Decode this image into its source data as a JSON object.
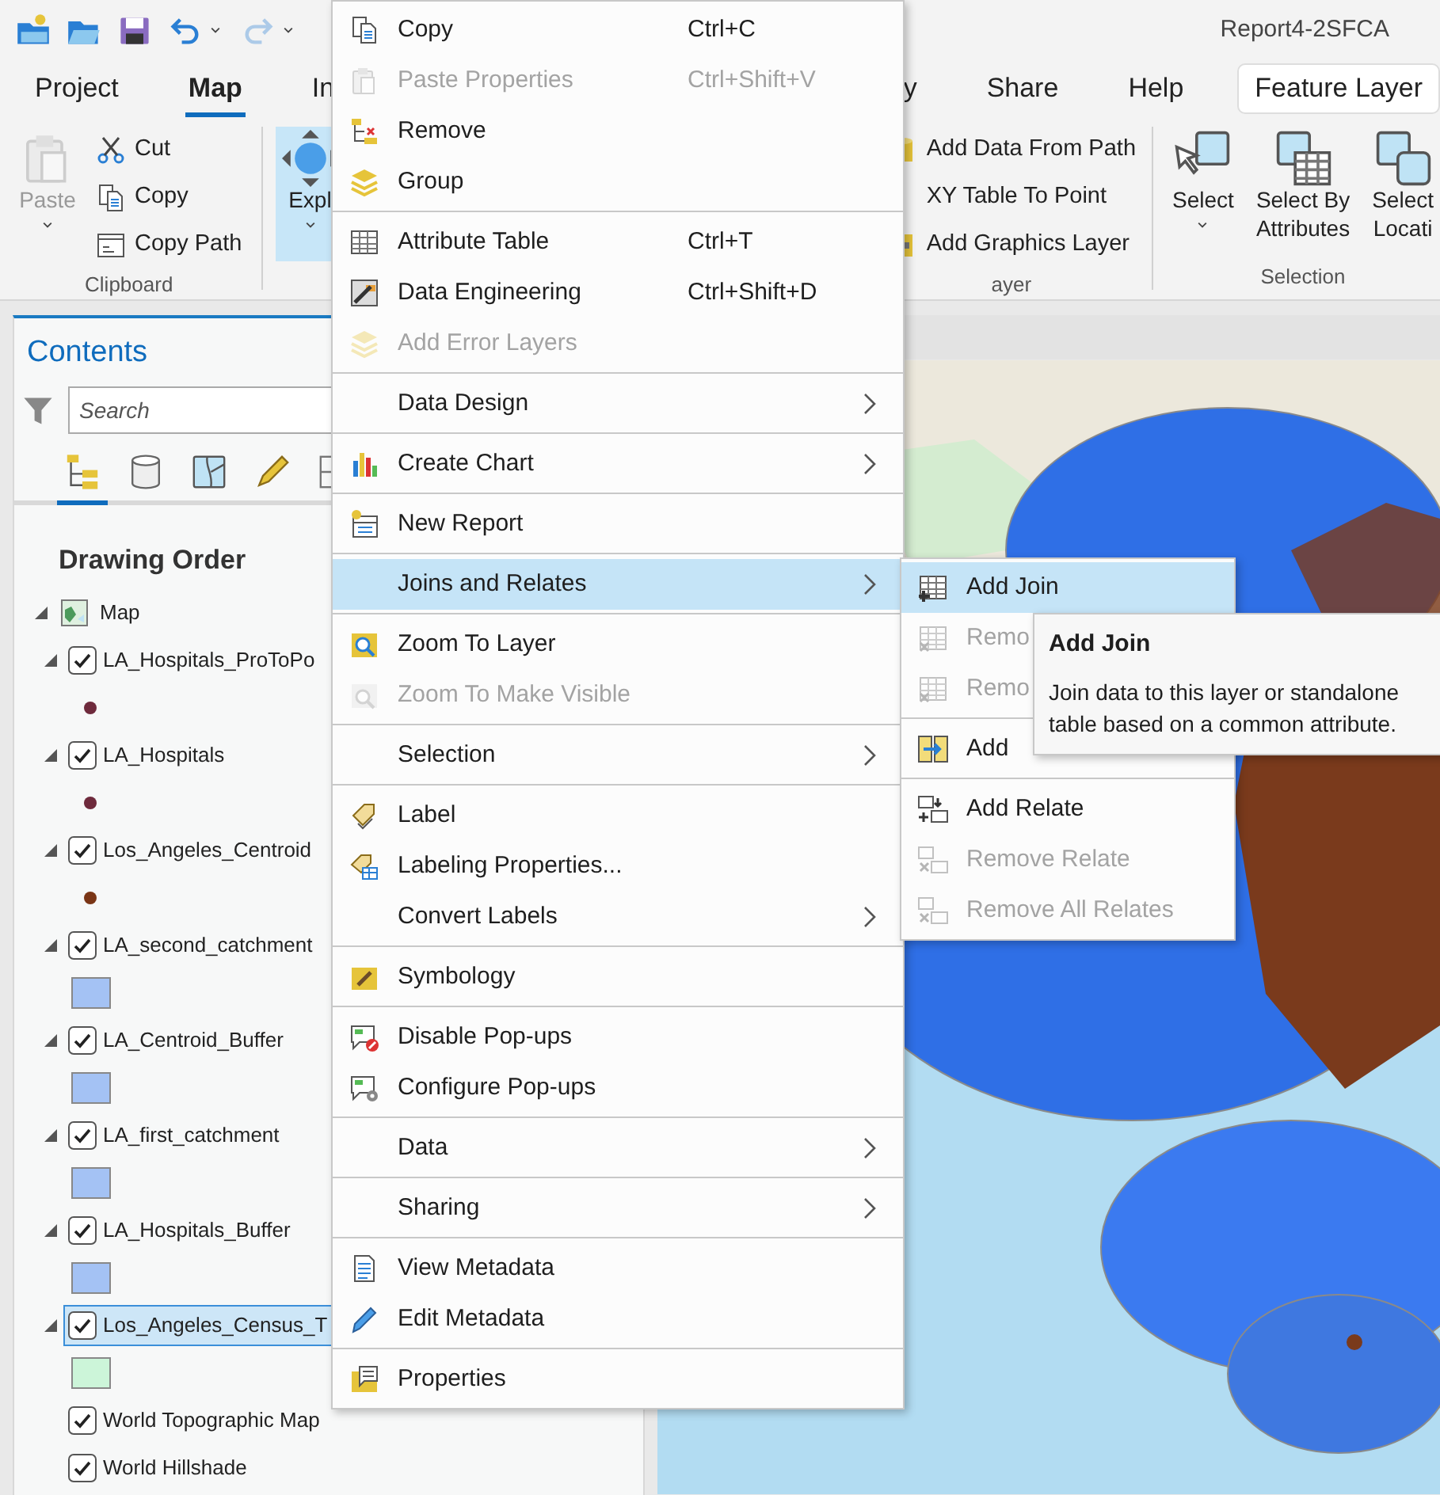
{
  "quick_access": [
    {
      "kind": "new-project",
      "disabled": false
    },
    {
      "kind": "open",
      "disabled": false
    },
    {
      "kind": "save",
      "disabled": false
    },
    {
      "kind": "undo",
      "disabled": false
    },
    {
      "kind": "caret",
      "disabled": false
    },
    {
      "kind": "redo",
      "disabled": true
    },
    {
      "kind": "caret",
      "disabled": false
    }
  ],
  "window": {
    "title": "Report4-2SFCA"
  },
  "ribbon_tabs": [
    {
      "label": "Project",
      "selected": false,
      "kind": "standard"
    },
    {
      "label": "Map",
      "selected": true,
      "kind": "standard"
    },
    {
      "label": "In",
      "selected": false,
      "kind": "standard"
    },
    {
      "label": "y",
      "selected": false,
      "kind": "standard"
    },
    {
      "label": "Share",
      "selected": false,
      "kind": "standard"
    },
    {
      "label": "Help",
      "selected": false,
      "kind": "standard"
    },
    {
      "label": "Feature Layer",
      "selected": false,
      "kind": "contextual"
    }
  ],
  "ribbon_groups": [
    {
      "label": "Clipboard",
      "large": [
        {
          "kind": "paste",
          "label": "Paste",
          "dropdown": true,
          "disabled": true,
          "selected": false
        }
      ],
      "small": [
        {
          "kind": "cut",
          "label": "Cut"
        },
        {
          "kind": "copy",
          "label": "Copy"
        },
        {
          "kind": "copy-path",
          "label": "Copy Path"
        }
      ]
    },
    {
      "large": [
        {
          "kind": "explore",
          "label": "Expl",
          "dropdown": true,
          "disabled": false,
          "selected": true
        }
      ]
    },
    {
      "label": "ayer",
      "small": [
        {
          "kind": "add-data-path",
          "label": "Add Data From Path"
        },
        {
          "kind": "xy-table",
          "label": "XY Table To Point"
        },
        {
          "kind": "add-graphics",
          "label": "Add Graphics Layer"
        }
      ]
    },
    {
      "label": "Selection",
      "large": [
        {
          "kind": "select",
          "label": "Select",
          "dropdown": true,
          "disabled": false,
          "selected": false
        },
        {
          "kind": "select-attributes",
          "label": "Select By\nAttributes",
          "dropdown": false,
          "disabled": false,
          "selected": false
        },
        {
          "kind": "select-location",
          "label": "Select\nLocati",
          "dropdown": false,
          "disabled": false,
          "selected": false
        }
      ]
    }
  ],
  "contents": {
    "title": "Contents",
    "search": {
      "placeholder": "Search"
    },
    "views": [
      {
        "kind": "drawing-order",
        "selected": true
      },
      {
        "kind": "data-source",
        "selected": false
      },
      {
        "kind": "selection",
        "selected": false
      },
      {
        "kind": "editing",
        "selected": false
      },
      {
        "kind": "snapping",
        "selected": false
      }
    ],
    "heading": "Drawing Order",
    "tree": [
      {
        "label": "Map",
        "kind": "map",
        "expanded": true,
        "children": [
          {
            "label": "LA_Hospitals_ProToPo",
            "kind": "layer",
            "expanded": true,
            "checked": true,
            "selected": false,
            "symbol": {
              "kind": "point",
              "color": "#6e2a3c"
            }
          },
          {
            "label": "LA_Hospitals",
            "kind": "layer",
            "expanded": true,
            "checked": true,
            "selected": false,
            "symbol": {
              "kind": "point",
              "color": "#6e2a3c"
            }
          },
          {
            "label": "Los_Angeles_Centroid",
            "kind": "layer",
            "expanded": true,
            "checked": true,
            "selected": false,
            "symbol": {
              "kind": "point",
              "color": "#7a3516"
            }
          },
          {
            "label": "LA_second_catchment",
            "kind": "layer",
            "expanded": true,
            "checked": true,
            "selected": false,
            "symbol": {
              "kind": "polygon",
              "color": "#a4c2f4"
            }
          },
          {
            "label": "LA_Centroid_Buffer",
            "kind": "layer",
            "expanded": true,
            "checked": true,
            "selected": false,
            "symbol": {
              "kind": "polygon",
              "color": "#a4c2f4"
            }
          },
          {
            "label": "LA_first_catchment",
            "kind": "layer",
            "expanded": true,
            "checked": true,
            "selected": false,
            "symbol": {
              "kind": "polygon",
              "color": "#a4c2f4"
            }
          },
          {
            "label": "LA_Hospitals_Buffer",
            "kind": "layer",
            "expanded": true,
            "checked": true,
            "selected": false,
            "symbol": {
              "kind": "polygon",
              "color": "#a4c2f4"
            }
          },
          {
            "label": "Los_Angeles_Census_T",
            "kind": "layer",
            "expanded": true,
            "checked": true,
            "selected": true,
            "symbol": {
              "kind": "polygon",
              "color": "#ccf5d9"
            }
          },
          {
            "label": "World Topographic Map",
            "kind": "basemap",
            "checked": true,
            "selected": false
          },
          {
            "label": "World Hillshade",
            "kind": "basemap",
            "checked": true,
            "selected": false
          }
        ]
      }
    ]
  },
  "context_menu": {
    "sections": [
      [
        {
          "label": "Copy",
          "kind": "copy",
          "shortcut": "Ctrl+C",
          "disabled": false,
          "selected": false,
          "submenu": false
        },
        {
          "label": "Paste Properties",
          "kind": "paste",
          "shortcut": "Ctrl+Shift+V",
          "disabled": true,
          "selected": false,
          "submenu": false
        },
        {
          "label": "Remove",
          "kind": "remove",
          "disabled": false,
          "selected": false,
          "submenu": false
        },
        {
          "label": "Group",
          "kind": "group",
          "disabled": false,
          "selected": false,
          "submenu": false
        }
      ],
      [
        {
          "label": "Attribute Table",
          "kind": "table",
          "shortcut": "Ctrl+T",
          "disabled": false,
          "selected": false,
          "submenu": false
        },
        {
          "label": "Data Engineering",
          "kind": "engineering",
          "shortcut": "Ctrl+Shift+D",
          "disabled": false,
          "selected": false,
          "submenu": false
        },
        {
          "label": "Add Error Layers",
          "kind": "group",
          "disabled": true,
          "selected": false,
          "submenu": false
        }
      ],
      [
        {
          "label": "Data Design",
          "kind": "plain",
          "disabled": false,
          "selected": false,
          "submenu": true
        }
      ],
      [
        {
          "label": "Create Chart",
          "kind": "chart",
          "disabled": false,
          "selected": false,
          "submenu": true
        }
      ],
      [
        {
          "label": "New Report",
          "kind": "report",
          "disabled": false,
          "selected": false,
          "submenu": false
        }
      ],
      [
        {
          "label": "Joins and Relates",
          "kind": "plain",
          "disabled": false,
          "selected": true,
          "submenu": true
        }
      ],
      [
        {
          "label": "Zoom To Layer",
          "kind": "zoom",
          "disabled": false,
          "selected": false,
          "submenu": false
        },
        {
          "label": "Zoom To Make Visible",
          "kind": "zoom-visible",
          "disabled": true,
          "selected": false,
          "submenu": false
        }
      ],
      [
        {
          "label": "Selection",
          "kind": "plain",
          "disabled": false,
          "selected": false,
          "submenu": true
        }
      ],
      [
        {
          "label": "Label",
          "kind": "label",
          "disabled": false,
          "selected": false,
          "submenu": false
        },
        {
          "label": "Labeling Properties...",
          "kind": "label-props",
          "disabled": false,
          "selected": false,
          "submenu": false
        },
        {
          "label": "Convert Labels",
          "kind": "plain",
          "disabled": false,
          "selected": false,
          "submenu": true
        }
      ],
      [
        {
          "label": "Symbology",
          "kind": "symbology",
          "disabled": false,
          "selected": false,
          "submenu": false
        }
      ],
      [
        {
          "label": "Disable Pop-ups",
          "kind": "popup-disable",
          "disabled": false,
          "selected": false,
          "submenu": false
        },
        {
          "label": "Configure Pop-ups",
          "kind": "popup-config",
          "disabled": false,
          "selected": false,
          "submenu": false
        }
      ],
      [
        {
          "label": "Data",
          "kind": "plain",
          "disabled": false,
          "selected": false,
          "submenu": true
        }
      ],
      [
        {
          "label": "Sharing",
          "kind": "plain",
          "disabled": false,
          "selected": false,
          "submenu": true
        }
      ],
      [
        {
          "label": "View Metadata",
          "kind": "metadata",
          "disabled": false,
          "selected": false,
          "submenu": false
        },
        {
          "label": "Edit Metadata",
          "kind": "edit",
          "disabled": false,
          "selected": false,
          "submenu": false
        }
      ],
      [
        {
          "label": "Properties",
          "kind": "properties",
          "disabled": false,
          "selected": false,
          "submenu": false
        }
      ]
    ]
  },
  "submenu": {
    "sections": [
      [
        {
          "label": "Add Join",
          "kind": "add-join",
          "disabled": false,
          "selected": true
        },
        {
          "label": "Remo",
          "kind": "remove-join",
          "disabled": true,
          "selected": false
        },
        {
          "label": "Remo",
          "kind": "remove-join",
          "disabled": true,
          "selected": false
        }
      ],
      [
        {
          "label": "Add",
          "kind": "spatial-join",
          "disabled": false,
          "selected": false
        }
      ],
      [
        {
          "label": "Add Relate",
          "kind": "add-relate",
          "disabled": false,
          "selected": false
        },
        {
          "label": "Remove Relate",
          "kind": "remove-relate",
          "disabled": true,
          "selected": false
        },
        {
          "label": "Remove All Relates",
          "kind": "remove-relate",
          "disabled": true,
          "selected": false
        }
      ]
    ]
  },
  "tooltip": {
    "title": "Add Join",
    "text": "Join data to this layer or standalone table based on a common attribute."
  }
}
